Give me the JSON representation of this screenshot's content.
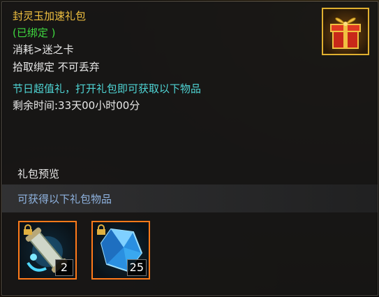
{
  "item": {
    "title": "封灵玉加速礼包",
    "bound_status": "(已绑定 )",
    "consume": "消耗>迷之卡",
    "pickup": "拾取绑定 不可丢弃",
    "festival": "节日超值礼，打开礼包即可获取以下物品",
    "remaining": "剩余时间:33天00小时00分"
  },
  "preview": {
    "label": "礼包预览",
    "band_text": "可获得以下礼包物品",
    "items": [
      {
        "icon": "scroll-icon",
        "count": "2"
      },
      {
        "icon": "crystal-icon",
        "count": "25"
      }
    ]
  },
  "colors": {
    "title": "#f0c040",
    "bound": "#3fd83f",
    "festival": "#4fd4d4",
    "band_text": "#8fb3e0",
    "slot_border": "#ff7a1a"
  }
}
